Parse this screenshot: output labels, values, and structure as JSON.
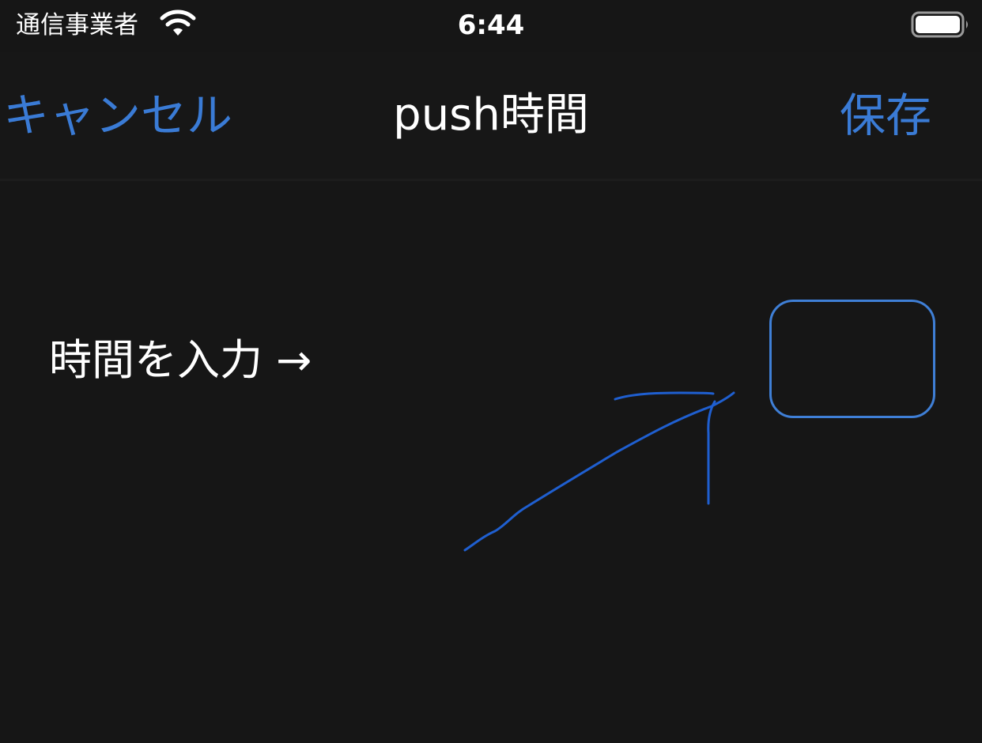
{
  "status_bar": {
    "carrier": "通信事業者",
    "time": "6:44",
    "wifi_icon": "wifi-icon",
    "battery_icon": "battery-icon",
    "battery_level": 1.0
  },
  "nav": {
    "cancel_label": "キャンセル",
    "title": "push時間",
    "save_label": "保存"
  },
  "content": {
    "prompt_label": "時間を入力 →",
    "time_input_value": "",
    "time_input_placeholder": ""
  },
  "colors": {
    "background": "#161616",
    "accent": "#3a7bd5",
    "annotation": "#1f5fd0"
  }
}
